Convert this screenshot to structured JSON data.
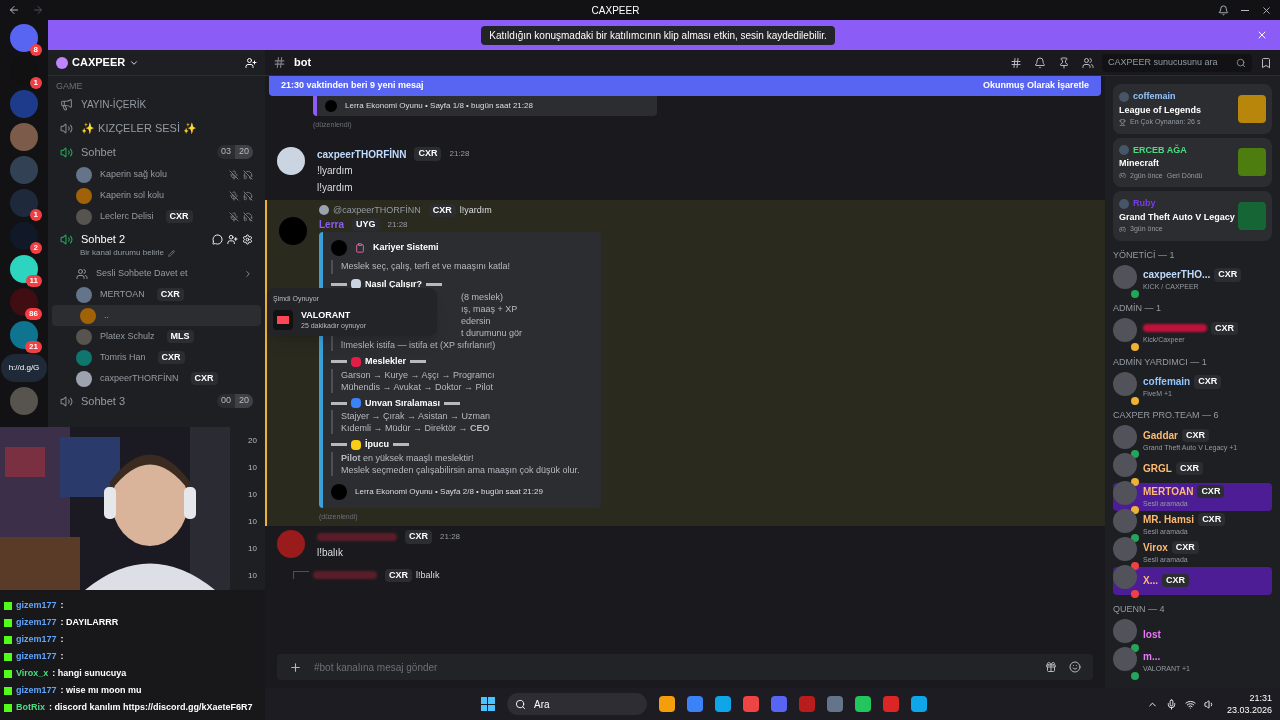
{
  "window": {
    "title": "CAXPEER"
  },
  "notice": {
    "text": "Katıldığın konuşmadaki bir katılımcının klip alması etkin, sesin kaydedilebilir."
  },
  "servers": [
    {
      "kind": "icon",
      "badge": "8"
    },
    {
      "kind": "icon",
      "badge": "1"
    },
    {
      "kind": "icon"
    },
    {
      "kind": "icon"
    },
    {
      "kind": "icon"
    },
    {
      "kind": "icon",
      "badge": "1"
    },
    {
      "kind": "icon",
      "badge": "2"
    },
    {
      "kind": "icon",
      "badge": "11"
    },
    {
      "kind": "icon",
      "badge": "86"
    },
    {
      "kind": "icon",
      "badge": "21"
    },
    {
      "kind": "text",
      "label": "h://d.g/G"
    },
    {
      "kind": "icon"
    }
  ],
  "server": {
    "name": "CAXPEER"
  },
  "channels": [
    {
      "kind": "category",
      "name": "GAME"
    },
    {
      "kind": "text",
      "name": "YAYIN-İÇERİK"
    },
    {
      "kind": "voice",
      "name": "✨ KIZÇELER SESİ ✨",
      "active": false
    },
    {
      "kind": "voice",
      "name": "Sohbet",
      "active": true,
      "count": "03",
      "limit": "20",
      "members": [
        {
          "name": "Kaperin sağ kolu",
          "muted": true
        },
        {
          "name": "Kaperin sol kolu",
          "muted": true
        },
        {
          "name": "Leclerc Delisi",
          "tag": "CXR",
          "muted": true
        }
      ]
    },
    {
      "kind": "voice",
      "name": "Sohbet 2",
      "active": true,
      "selected": true,
      "status": "Bir kanal durumu belirle",
      "invite": "Sesli Sohbete Davet et",
      "members": [
        {
          "name": "MERTOAN",
          "tag": "CXR"
        },
        {
          "name": ".."
        },
        {
          "name": "Platex Schulz",
          "tag": "MLS"
        },
        {
          "name": "Tomris Han",
          "tag": "CXR"
        },
        {
          "name": "caxpeerTHORFİNN",
          "tag": "CXR"
        }
      ]
    },
    {
      "kind": "voice",
      "name": "Sohbet 3",
      "active": false,
      "count": "00",
      "limit": "20"
    }
  ],
  "hidden_counts": [
    "20",
    "10",
    "10",
    "10",
    "10",
    "10"
  ],
  "stream_chat": [
    {
      "user": "gizem177",
      "text": ":"
    },
    {
      "user": "gizem177",
      "text": ": DAYILARRR"
    },
    {
      "user": "gizem177",
      "text": ":"
    },
    {
      "user": "gizem177",
      "text": ":"
    },
    {
      "user": "Virox_x",
      "text": ": hangi sunucuya"
    },
    {
      "user": "gizem177",
      "text": ": wise mı moon mu"
    },
    {
      "user": "BotRix",
      "text": ": discord kanılım https://discord.gg/kXaeteF6R7"
    }
  ],
  "channel_header": {
    "name": "bot",
    "search_placeholder": "CAXPEER sunucusunu ara"
  },
  "new_messages": {
    "text": "21:30 vaktinden beri 9 yeni mesaj",
    "action": "Okunmuş Olarak İşaretle"
  },
  "prev_footer": "Lerra Ekonomi Oyunu • Sayfa 1/8 • bugün saat 21:28",
  "edited": "(düzenlendi)",
  "messages": [
    {
      "author": "caxpeerTHORFİNN",
      "tag": "CXR",
      "time": "21:28",
      "lines": [
        "!lyardım",
        "l!yardım"
      ]
    },
    {
      "author": "Lerra",
      "tag": "UYG",
      "time": "21:28",
      "highlighted": true,
      "reply": {
        "author": "@caxpeerTHORFİNN",
        "tag": "CXR",
        "text": "l!yardım"
      },
      "embed": {
        "title": "Kariyer Sistemi",
        "quote": "Meslek seç, çalış, terfi et ve maaşını katla!",
        "sections": [
          {
            "title": "Nasıl Çalışır?",
            "lines": [
              "(8 meslek)",
              "ış, maaş + XP",
              "edersin",
              "t durumunu gör"
            ],
            "covered": true,
            "last": "l!meslek istifa — istifa et (XP sıfırlanır!)"
          },
          {
            "title": "Meslekler",
            "lines": [
              "Garson → Kurye → Aşçı → Programcı",
              "Mühendis → Avukat → Doktor → Pilot"
            ]
          },
          {
            "title": "Unvan Sıralaması",
            "lines": [
              "Stajyer → Çırak → Asistan → Uzman",
              "Kıdemli → Müdür → Direktör → **CEO**"
            ]
          },
          {
            "title": "İpucu",
            "lines": [
              "**Pilot** en yüksek maaşlı meslektir!",
              "Meslek seçmeden çalışabilirsin ama maaşın çok düşük olur."
            ]
          }
        ],
        "footer": "Lerra Ekonomi Oyunu • Sayfa 2/8 • bugün saat 21:29"
      },
      "edited": "(düzenlendi)"
    },
    {
      "tag": "CXR",
      "time": "21:28",
      "lines": [
        "l!balık"
      ],
      "reply_preview": {
        "tag": "CXR",
        "text": "l!balık"
      }
    }
  ],
  "popup": {
    "heading": "Şimdi Oynuyor",
    "game": "VALORANT",
    "elapsed": "25 dakikadır oynuyor"
  },
  "composer": {
    "placeholder": "#bot kanalına mesaj gönder"
  },
  "activities": [
    {
      "user": "coffemain",
      "game": "League of Legends",
      "detail": "En Çok Oynanan: 26 s",
      "color": "#93c5fd"
    },
    {
      "user": "ERCEB AĞA",
      "game": "Minecraft",
      "detail": "2gün önce",
      "extra": "Geri Döndü",
      "color": "#4ade80"
    },
    {
      "user": "Ruby",
      "game": "Grand Theft Auto V Legacy",
      "detail": "3gün önce",
      "color": "#7c3aed"
    }
  ],
  "member_groups": [
    {
      "title": "YÖNETİCİ — 1",
      "members": [
        {
          "name": "caxpeerTHO...",
          "tag": "CXR",
          "status": "KICK / CAXPEER",
          "color": "#bfdbfe",
          "status_dot": {
            "color": "#23a55a"
          }
        }
      ]
    },
    {
      "title": "ADMİN — 1",
      "members": [
        {
          "tag": "CXR",
          "status": "Kick/Caxpeer",
          "color": "#be123c",
          "status_dot": {
            "color": "#f0b232"
          }
        }
      ]
    },
    {
      "title": "ADMİN YARDIMCI — 1",
      "members": [
        {
          "name": "coffemain",
          "tag": "CXR",
          "status": "FiveM +1",
          "color": "#93c5fd",
          "status_dot": {
            "color": "#f0b232"
          }
        }
      ]
    },
    {
      "title": "CAXPER PRO.TEAM — 6",
      "members": [
        {
          "name": "Gaddar",
          "tag": "CXR",
          "status": "Grand Theft Auto V Legacy +1",
          "color": "#fdba74",
          "status_dot": {
            "color": "#23a55a"
          }
        },
        {
          "name": "GRGL",
          "tag": "CXR",
          "color": "#fdba74",
          "status_dot": {
            "color": "#f0b232"
          }
        },
        {
          "name": "MERTOAN",
          "tag": "CXR",
          "status": "Sesli aramada",
          "color": "#fdba74",
          "status_dot": {
            "color": "#f0b232"
          },
          "banner": true
        },
        {
          "name": "MR. Hamsi",
          "tag": "CXR",
          "status": "Sesli aramada",
          "color": "#fdba74",
          "status_dot": {
            "color": "#23a55a"
          }
        },
        {
          "name": "Virox",
          "tag": "CXR",
          "status": "Sesli aramada",
          "color": "#fdba74",
          "status_dot": {
            "color": "#f23f43"
          }
        },
        {
          "name": "X...",
          "tag": "CXR",
          "color": "#fdba74",
          "status_dot": {
            "color": "#f23f43"
          },
          "banner": true
        }
      ]
    },
    {
      "title": "QUENN — 4",
      "members": [
        {
          "name": "lost",
          "color": "#e879f9",
          "status_dot": {
            "color": "#23a55a"
          }
        },
        {
          "name": "m...",
          "status": "VALORANT +1",
          "color": "#e879f9",
          "status_dot": {
            "color": "#23a55a"
          }
        }
      ]
    }
  ],
  "taskbar": {
    "search": "Ara",
    "time": "21:31",
    "date": "23.03.2026"
  }
}
